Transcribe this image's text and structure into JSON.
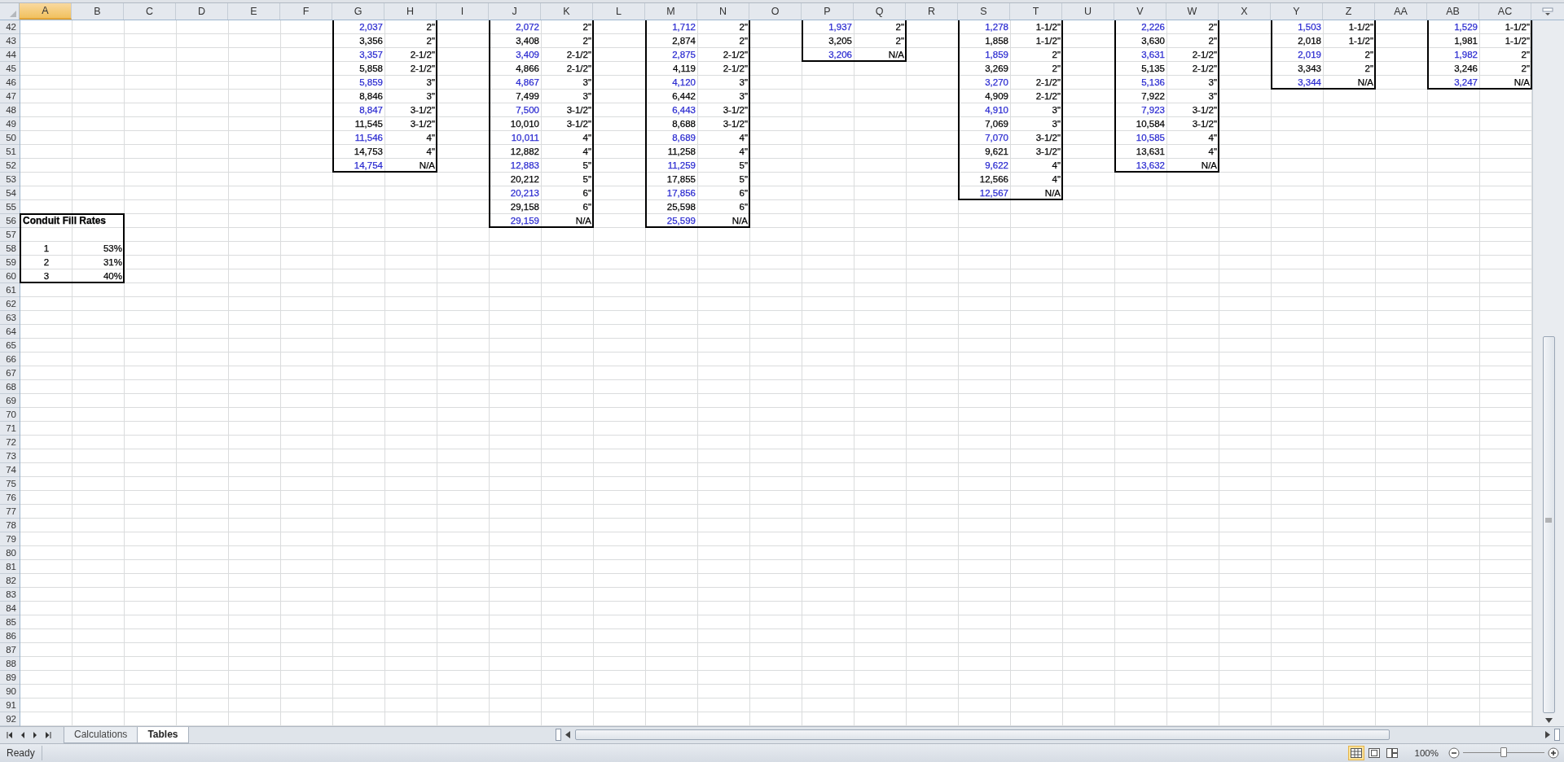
{
  "columns": [
    {
      "label": "A",
      "selected": true
    },
    {
      "label": "B",
      "selected": false
    },
    {
      "label": "C",
      "selected": false
    },
    {
      "label": "D",
      "selected": false
    },
    {
      "label": "E",
      "selected": false
    },
    {
      "label": "F",
      "selected": false
    },
    {
      "label": "G",
      "selected": false
    },
    {
      "label": "H",
      "selected": false
    },
    {
      "label": "I",
      "selected": false
    },
    {
      "label": "J",
      "selected": false
    },
    {
      "label": "K",
      "selected": false
    },
    {
      "label": "L",
      "selected": false
    },
    {
      "label": "M",
      "selected": false
    },
    {
      "label": "N",
      "selected": false
    },
    {
      "label": "O",
      "selected": false
    },
    {
      "label": "P",
      "selected": false
    },
    {
      "label": "Q",
      "selected": false
    },
    {
      "label": "R",
      "selected": false
    },
    {
      "label": "S",
      "selected": false
    },
    {
      "label": "T",
      "selected": false
    },
    {
      "label": "U",
      "selected": false
    },
    {
      "label": "V",
      "selected": false
    },
    {
      "label": "W",
      "selected": false
    },
    {
      "label": "X",
      "selected": false
    },
    {
      "label": "Y",
      "selected": false
    },
    {
      "label": "Z",
      "selected": false
    },
    {
      "label": "AA",
      "selected": false
    },
    {
      "label": "AB",
      "selected": false
    },
    {
      "label": "AC",
      "selected": false
    }
  ],
  "row_numbers": [
    "42",
    "43",
    "44",
    "45",
    "46",
    "47",
    "48",
    "49",
    "50",
    "51",
    "52",
    "53",
    "54",
    "55",
    "56",
    "57",
    "58",
    "59",
    "60",
    "61",
    "62",
    "63",
    "64",
    "65",
    "66",
    "67",
    "68",
    "69",
    "70",
    "71",
    "72",
    "73",
    "74",
    "75",
    "76",
    "77",
    "78",
    "79",
    "80",
    "81",
    "82",
    "83",
    "84",
    "85",
    "86",
    "87",
    "88",
    "89",
    "90",
    "91",
    "92"
  ],
  "tables": [
    {
      "rows": [
        {
          "value": "2,037",
          "size": "2\"",
          "color": "#2a2ad0"
        },
        {
          "value": "3,356",
          "size": "2\"",
          "color": "#000000"
        },
        {
          "value": "3,357",
          "size": "2-1/2\"",
          "color": "#2a2ad0"
        },
        {
          "value": "5,858",
          "size": "2-1/2\"",
          "color": "#000000"
        },
        {
          "value": "5,859",
          "size": "3\"",
          "color": "#2a2ad0"
        },
        {
          "value": "8,846",
          "size": "3\"",
          "color": "#000000"
        },
        {
          "value": "8,847",
          "size": "3-1/2\"",
          "color": "#2a2ad0"
        },
        {
          "value": "11,545",
          "size": "3-1/2\"",
          "color": "#000000"
        },
        {
          "value": "11,546",
          "size": "4\"",
          "color": "#2a2ad0"
        },
        {
          "value": "14,753",
          "size": "4\"",
          "color": "#000000"
        },
        {
          "value": "14,754",
          "size": "N/A",
          "color": "#2a2ad0"
        }
      ]
    },
    {
      "rows": [
        {
          "value": "2,072",
          "size": "2\"",
          "color": "#2a2ad0"
        },
        {
          "value": "3,408",
          "size": "2\"",
          "color": "#000000"
        },
        {
          "value": "3,409",
          "size": "2-1/2\"",
          "color": "#2a2ad0"
        },
        {
          "value": "4,866",
          "size": "2-1/2\"",
          "color": "#000000"
        },
        {
          "value": "4,867",
          "size": "3\"",
          "color": "#2a2ad0"
        },
        {
          "value": "7,499",
          "size": "3\"",
          "color": "#000000"
        },
        {
          "value": "7,500",
          "size": "3-1/2\"",
          "color": "#2a2ad0"
        },
        {
          "value": "10,010",
          "size": "3-1/2\"",
          "color": "#000000"
        },
        {
          "value": "10,011",
          "size": "4\"",
          "color": "#2a2ad0"
        },
        {
          "value": "12,882",
          "size": "4\"",
          "color": "#000000"
        },
        {
          "value": "12,883",
          "size": "5\"",
          "color": "#2a2ad0"
        },
        {
          "value": "20,212",
          "size": "5\"",
          "color": "#000000"
        },
        {
          "value": "20,213",
          "size": "6\"",
          "color": "#2a2ad0"
        },
        {
          "value": "29,158",
          "size": "6\"",
          "color": "#000000"
        },
        {
          "value": "29,159",
          "size": "N/A",
          "color": "#2a2ad0"
        }
      ]
    },
    {
      "rows": [
        {
          "value": "1,712",
          "size": "2\"",
          "color": "#2a2ad0"
        },
        {
          "value": "2,874",
          "size": "2\"",
          "color": "#000000"
        },
        {
          "value": "2,875",
          "size": "2-1/2\"",
          "color": "#2a2ad0"
        },
        {
          "value": "4,119",
          "size": "2-1/2\"",
          "color": "#000000"
        },
        {
          "value": "4,120",
          "size": "3\"",
          "color": "#2a2ad0"
        },
        {
          "value": "6,442",
          "size": "3\"",
          "color": "#000000"
        },
        {
          "value": "6,443",
          "size": "3-1/2\"",
          "color": "#2a2ad0"
        },
        {
          "value": "8,688",
          "size": "3-1/2\"",
          "color": "#000000"
        },
        {
          "value": "8,689",
          "size": "4\"",
          "color": "#2a2ad0"
        },
        {
          "value": "11,258",
          "size": "4\"",
          "color": "#000000"
        },
        {
          "value": "11,259",
          "size": "5\"",
          "color": "#2a2ad0"
        },
        {
          "value": "17,855",
          "size": "5\"",
          "color": "#000000"
        },
        {
          "value": "17,856",
          "size": "6\"",
          "color": "#2a2ad0"
        },
        {
          "value": "25,598",
          "size": "6\"",
          "color": "#000000"
        },
        {
          "value": "25,599",
          "size": "N/A",
          "color": "#2a2ad0"
        }
      ]
    },
    {
      "rows": [
        {
          "value": "1,937",
          "size": "2\"",
          "color": "#2a2ad0"
        },
        {
          "value": "3,205",
          "size": "2\"",
          "color": "#000000"
        },
        {
          "value": "3,206",
          "size": "N/A",
          "color": "#2a2ad0"
        }
      ]
    },
    {
      "rows": [
        {
          "value": "1,278",
          "size": "1-1/2\"",
          "color": "#2a2ad0"
        },
        {
          "value": "1,858",
          "size": "1-1/2\"",
          "color": "#000000"
        },
        {
          "value": "1,859",
          "size": "2\"",
          "color": "#2a2ad0"
        },
        {
          "value": "3,269",
          "size": "2\"",
          "color": "#000000"
        },
        {
          "value": "3,270",
          "size": "2-1/2\"",
          "color": "#2a2ad0"
        },
        {
          "value": "4,909",
          "size": "2-1/2\"",
          "color": "#000000"
        },
        {
          "value": "4,910",
          "size": "3\"",
          "color": "#2a2ad0"
        },
        {
          "value": "7,069",
          "size": "3\"",
          "color": "#000000"
        },
        {
          "value": "7,070",
          "size": "3-1/2\"",
          "color": "#2a2ad0"
        },
        {
          "value": "9,621",
          "size": "3-1/2\"",
          "color": "#000000"
        },
        {
          "value": "9,622",
          "size": "4\"",
          "color": "#2a2ad0"
        },
        {
          "value": "12,566",
          "size": "4\"",
          "color": "#000000"
        },
        {
          "value": "12,567",
          "size": "N/A",
          "color": "#2a2ad0"
        }
      ]
    },
    {
      "rows": [
        {
          "value": "2,226",
          "size": "2\"",
          "color": "#2a2ad0"
        },
        {
          "value": "3,630",
          "size": "2\"",
          "color": "#000000"
        },
        {
          "value": "3,631",
          "size": "2-1/2\"",
          "color": "#2a2ad0"
        },
        {
          "value": "5,135",
          "size": "2-1/2\"",
          "color": "#000000"
        },
        {
          "value": "5,136",
          "size": "3\"",
          "color": "#2a2ad0"
        },
        {
          "value": "7,922",
          "size": "3\"",
          "color": "#000000"
        },
        {
          "value": "7,923",
          "size": "3-1/2\"",
          "color": "#2a2ad0"
        },
        {
          "value": "10,584",
          "size": "3-1/2\"",
          "color": "#000000"
        },
        {
          "value": "10,585",
          "size": "4\"",
          "color": "#2a2ad0"
        },
        {
          "value": "13,631",
          "size": "4\"",
          "color": "#000000"
        },
        {
          "value": "13,632",
          "size": "N/A",
          "color": "#2a2ad0"
        }
      ]
    },
    {
      "rows": [
        {
          "value": "1,503",
          "size": "1-1/2\"",
          "color": "#2a2ad0"
        },
        {
          "value": "2,018",
          "size": "1-1/2\"",
          "color": "#000000"
        },
        {
          "value": "2,019",
          "size": "2\"",
          "color": "#2a2ad0"
        },
        {
          "value": "3,343",
          "size": "2\"",
          "color": "#000000"
        },
        {
          "value": "3,344",
          "size": "N/A",
          "color": "#2a2ad0"
        }
      ]
    },
    {
      "rows": [
        {
          "value": "1,529",
          "size": "1-1/2\"",
          "color": "#2a2ad0"
        },
        {
          "value": "1,981",
          "size": "1-1/2\"",
          "color": "#000000"
        },
        {
          "value": "1,982",
          "size": "2\"",
          "color": "#2a2ad0"
        },
        {
          "value": "3,246",
          "size": "2\"",
          "color": "#000000"
        },
        {
          "value": "3,247",
          "size": "N/A",
          "color": "#2a2ad0"
        }
      ]
    }
  ],
  "fill_rates": {
    "title": "Conduit Fill Rates",
    "rows": [
      {
        "label": "1",
        "rate": "53%"
      },
      {
        "label": "2",
        "rate": "31%"
      },
      {
        "label": "3",
        "rate": "40%"
      }
    ]
  },
  "sheet_tabs": [
    {
      "label": "Calculations",
      "selected": false
    },
    {
      "label": "Tables",
      "selected": true
    }
  ],
  "status_bar": {
    "status": "Ready",
    "views": [
      {
        "kind": "normal",
        "selected": true
      },
      {
        "kind": "page_layout",
        "selected": false
      },
      {
        "kind": "page_break",
        "selected": false
      }
    ],
    "zoom": {
      "percent": "100%",
      "level": 0.5
    }
  }
}
